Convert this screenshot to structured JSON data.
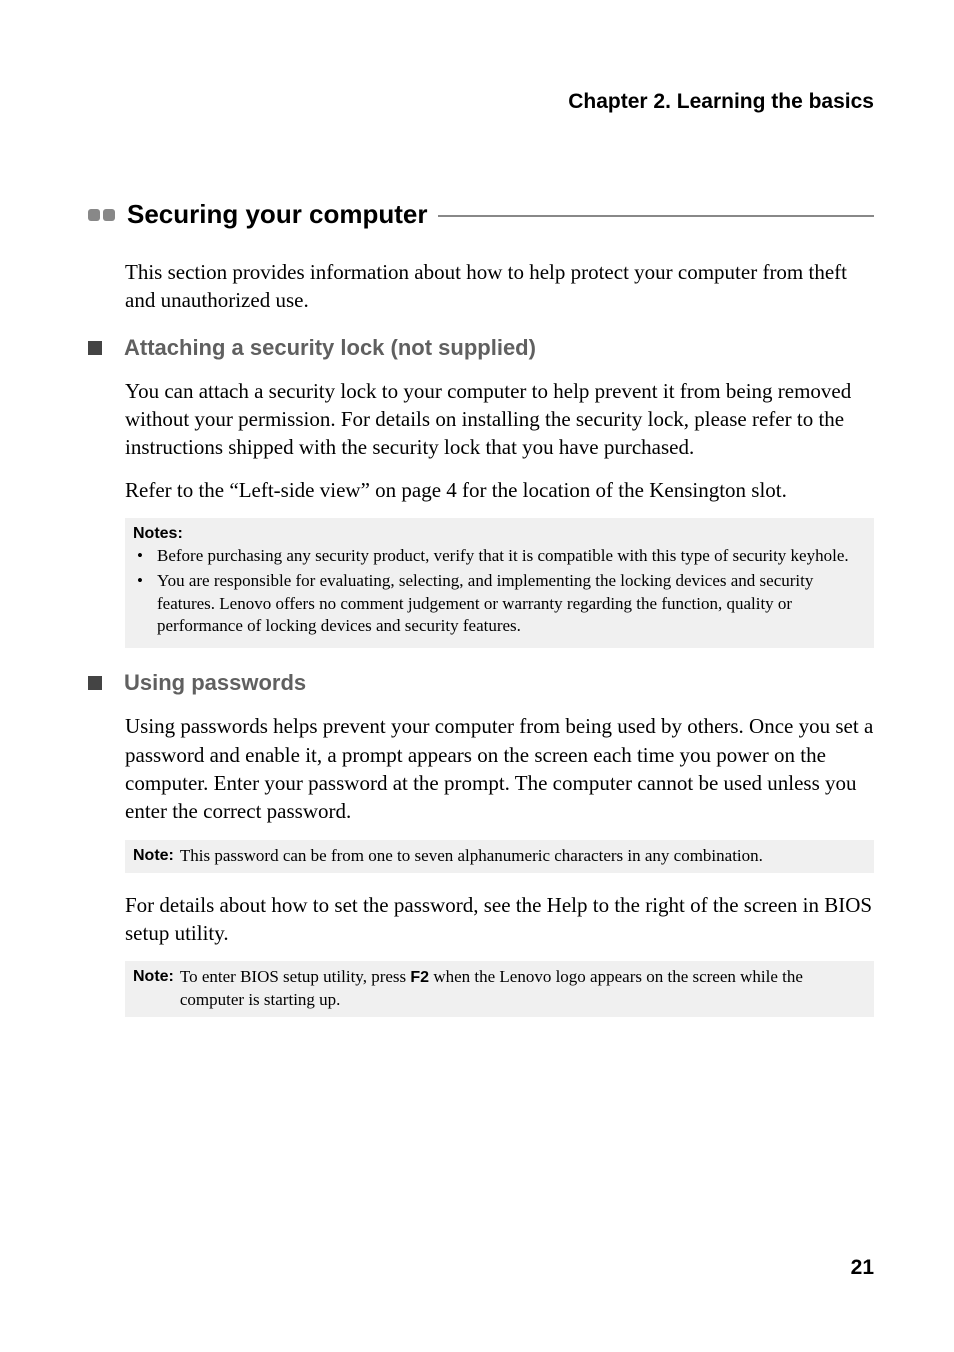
{
  "chapter": "Chapter 2. Learning the basics",
  "mainHeading": "Securing your computer",
  "intro": "This section provides information about how to help protect your computer from theft and unauthorized use.",
  "section1": {
    "title": "Attaching a security lock (not supplied)",
    "para1": "You can attach a security lock to your computer to help prevent it from being removed without your permission. For details on installing the security lock, please refer to the instructions shipped with the security lock that you have purchased.",
    "para2": "Refer to the “Left-side view” on page 4 for the location of the Kensington slot.",
    "notesLabel": "Notes:",
    "notes": [
      "Before purchasing any security product, verify that it is compatible with this type of security keyhole.",
      "You are responsible for evaluating, selecting, and implementing the locking devices and security features. Lenovo offers no comment judgement or warranty regarding the function, quality or performance of locking devices and security features."
    ]
  },
  "section2": {
    "title": "Using passwords",
    "para1": "Using passwords helps prevent your computer from being used by others. Once you set a password and enable it, a prompt appears on the screen each time you power on the computer. Enter your password at the prompt. The computer cannot be used unless you enter the correct password.",
    "note1Label": "Note:",
    "note1": "This password can be from one to seven alphanumeric characters in any combination.",
    "para2": "For details about how to set the password, see the Help to the right of the screen in BIOS setup utility.",
    "note2Label": "Note:",
    "note2Pre": "To enter BIOS setup utility, press ",
    "note2Key": "F2",
    "note2Post": " when the Lenovo logo appears on the screen while the computer is starting up."
  },
  "pageNumber": "21"
}
